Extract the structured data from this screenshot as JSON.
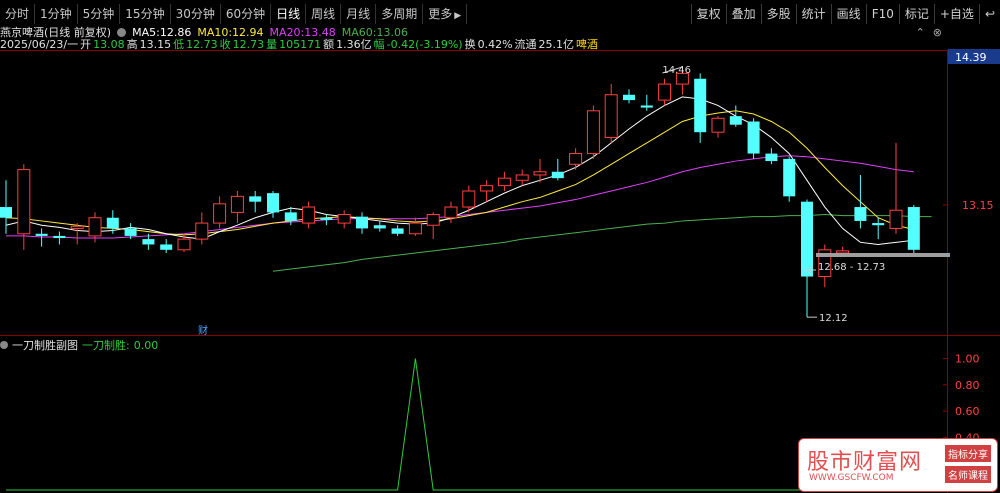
{
  "toolbar": {
    "periods": [
      "分时",
      "1分钟",
      "5分钟",
      "15分钟",
      "30分钟",
      "60分钟",
      "日线",
      "周线",
      "月线",
      "多周期"
    ],
    "more": "更多",
    "right_buttons": [
      "复权",
      "叠加",
      "多股",
      "统计",
      "画线",
      "F10",
      "标记",
      "+自选"
    ],
    "back_icon": "return-arrow-icon"
  },
  "info": {
    "stock_name": "燕京啤酒(日线 前复权)",
    "ma5_label": "MA5:",
    "ma5": "12.86",
    "ma10_label": "MA10:",
    "ma10": "12.94",
    "ma20_label": "MA20:",
    "ma20": "13.48",
    "ma60_label": "MA60:",
    "ma60": "13.06",
    "date": "2025/06/23/一",
    "open_label": "开",
    "open": "13.08",
    "high_label": "高",
    "high": "13.15",
    "low_label": "低",
    "low": "12.73",
    "close_label": "收",
    "close": "12.73",
    "vol_label": "量",
    "vol": "105171",
    "amt_label": "额",
    "amt": "1.36亿",
    "chg_label": "幅",
    "chg": "-0.42(-3.19%)",
    "turnover_label": "换",
    "turnover": "0.42%",
    "float_label": "流通",
    "float": "25.1亿",
    "sector": "啤酒"
  },
  "price_axis": {
    "tag": "14.39",
    "mid": "13.15"
  },
  "annotations": {
    "high": "14.46",
    "low": "12.12",
    "range": "12.68 - 12.73",
    "finance": "财"
  },
  "sub": {
    "title": "一刀制胜副图",
    "value_label": "一刀制胜:",
    "value": "0.00",
    "axis": [
      "1.00",
      "0.80",
      "0.60",
      "0.40"
    ]
  },
  "watermark": {
    "title": "股市财富网",
    "url": "WWW.GSCFW.COM",
    "tag1": "指标分享",
    "tag2": "名师课程"
  },
  "colors": {
    "up": "#ff4040",
    "down": "#54ffff",
    "ma5": "#ffffff",
    "ma10": "#ffeb3b",
    "ma20": "#e040fb",
    "ma60": "#4caf50"
  },
  "chart_data": {
    "type": "candlestick",
    "ylim": [
      12.0,
      14.6
    ],
    "candles": [
      {
        "o": 13.15,
        "h": 13.4,
        "l": 12.9,
        "c": 13.05
      },
      {
        "o": 12.9,
        "h": 13.55,
        "l": 12.75,
        "c": 13.5
      },
      {
        "o": 12.9,
        "h": 12.95,
        "l": 12.78,
        "c": 12.88
      },
      {
        "o": 12.88,
        "h": 12.92,
        "l": 12.8,
        "c": 12.86
      },
      {
        "o": 12.95,
        "h": 13.0,
        "l": 12.8,
        "c": 12.97
      },
      {
        "o": 12.88,
        "h": 13.1,
        "l": 12.82,
        "c": 13.05
      },
      {
        "o": 13.05,
        "h": 13.12,
        "l": 12.9,
        "c": 12.95
      },
      {
        "o": 12.95,
        "h": 13.0,
        "l": 12.85,
        "c": 12.88
      },
      {
        "o": 12.85,
        "h": 12.9,
        "l": 12.75,
        "c": 12.8
      },
      {
        "o": 12.8,
        "h": 12.85,
        "l": 12.72,
        "c": 12.75
      },
      {
        "o": 12.75,
        "h": 12.9,
        "l": 12.73,
        "c": 12.85
      },
      {
        "o": 12.85,
        "h": 13.1,
        "l": 12.8,
        "c": 13.0
      },
      {
        "o": 13.0,
        "h": 13.25,
        "l": 12.95,
        "c": 13.18
      },
      {
        "o": 13.1,
        "h": 13.3,
        "l": 13.0,
        "c": 13.25
      },
      {
        "o": 13.25,
        "h": 13.3,
        "l": 13.1,
        "c": 13.2
      },
      {
        "o": 13.28,
        "h": 13.3,
        "l": 13.05,
        "c": 13.1
      },
      {
        "o": 13.1,
        "h": 13.15,
        "l": 12.98,
        "c": 13.02
      },
      {
        "o": 13.0,
        "h": 13.2,
        "l": 12.95,
        "c": 13.15
      },
      {
        "o": 13.05,
        "h": 13.08,
        "l": 12.98,
        "c": 13.03
      },
      {
        "o": 13.0,
        "h": 13.12,
        "l": 12.95,
        "c": 13.08
      },
      {
        "o": 13.06,
        "h": 13.1,
        "l": 12.9,
        "c": 12.95
      },
      {
        "o": 12.98,
        "h": 13.02,
        "l": 12.92,
        "c": 12.95
      },
      {
        "o": 12.95,
        "h": 12.98,
        "l": 12.88,
        "c": 12.9
      },
      {
        "o": 12.9,
        "h": 13.05,
        "l": 12.88,
        "c": 13.0
      },
      {
        "o": 12.98,
        "h": 13.1,
        "l": 12.85,
        "c": 13.08
      },
      {
        "o": 13.05,
        "h": 13.2,
        "l": 13.0,
        "c": 13.15
      },
      {
        "o": 13.15,
        "h": 13.35,
        "l": 13.1,
        "c": 13.3
      },
      {
        "o": 13.3,
        "h": 13.4,
        "l": 13.2,
        "c": 13.35
      },
      {
        "o": 13.35,
        "h": 13.48,
        "l": 13.3,
        "c": 13.42
      },
      {
        "o": 13.4,
        "h": 13.5,
        "l": 13.35,
        "c": 13.45
      },
      {
        "o": 13.45,
        "h": 13.6,
        "l": 13.38,
        "c": 13.48
      },
      {
        "o": 13.48,
        "h": 13.6,
        "l": 13.4,
        "c": 13.42
      },
      {
        "o": 13.55,
        "h": 13.7,
        "l": 13.5,
        "c": 13.65
      },
      {
        "o": 13.65,
        "h": 14.1,
        "l": 13.6,
        "c": 14.05
      },
      {
        "o": 13.8,
        "h": 14.3,
        "l": 13.75,
        "c": 14.2
      },
      {
        "o": 14.2,
        "h": 14.25,
        "l": 14.12,
        "c": 14.15
      },
      {
        "o": 14.1,
        "h": 14.2,
        "l": 14.05,
        "c": 14.08
      },
      {
        "o": 14.15,
        "h": 14.35,
        "l": 14.1,
        "c": 14.3
      },
      {
        "o": 14.3,
        "h": 14.46,
        "l": 14.2,
        "c": 14.4
      },
      {
        "o": 14.35,
        "h": 14.4,
        "l": 13.75,
        "c": 13.85
      },
      {
        "o": 13.85,
        "h": 14.0,
        "l": 13.8,
        "c": 13.98
      },
      {
        "o": 14.0,
        "h": 14.1,
        "l": 13.9,
        "c": 13.92
      },
      {
        "o": 13.95,
        "h": 13.98,
        "l": 13.6,
        "c": 13.65
      },
      {
        "o": 13.65,
        "h": 13.7,
        "l": 13.55,
        "c": 13.58
      },
      {
        "o": 13.6,
        "h": 13.62,
        "l": 13.2,
        "c": 13.25
      },
      {
        "o": 13.2,
        "h": 13.22,
        "l": 12.12,
        "c": 12.5
      },
      {
        "o": 12.5,
        "h": 12.8,
        "l": 12.4,
        "c": 12.75
      },
      {
        "o": 12.72,
        "h": 12.78,
        "l": 12.7,
        "c": 12.74
      },
      {
        "o": 13.15,
        "h": 13.45,
        "l": 12.95,
        "c": 13.02
      },
      {
        "o": 13.0,
        "h": 13.05,
        "l": 12.85,
        "c": 12.98
      },
      {
        "o": 12.95,
        "h": 13.75,
        "l": 12.9,
        "c": 13.12
      },
      {
        "o": 13.15,
        "h": 13.17,
        "l": 12.72,
        "c": 12.75
      }
    ],
    "ma5": [
      12.98,
      13.02,
      12.98,
      12.96,
      12.93,
      12.92,
      12.93,
      12.96,
      12.94,
      12.9,
      12.87,
      12.85,
      12.92,
      12.98,
      13.05,
      13.1,
      13.14,
      13.12,
      13.08,
      13.06,
      13.04,
      13.02,
      13.0,
      12.99,
      13.0,
      13.05,
      13.12,
      13.2,
      13.28,
      13.35,
      13.4,
      13.45,
      13.52,
      13.62,
      13.75,
      13.88,
      14.0,
      14.1,
      14.18,
      14.16,
      14.1,
      14.0,
      13.92,
      13.8,
      13.65,
      13.4,
      13.15,
      12.95,
      12.82,
      12.8,
      12.82,
      12.84
    ],
    "ma10": [
      13.05,
      13.04,
      13.02,
      13.0,
      12.98,
      12.96,
      12.95,
      12.94,
      12.92,
      12.9,
      12.89,
      12.9,
      12.92,
      12.94,
      12.97,
      13.0,
      13.02,
      13.04,
      13.05,
      13.06,
      13.05,
      13.04,
      13.02,
      13.01,
      13.02,
      13.04,
      13.07,
      13.1,
      13.15,
      13.2,
      13.24,
      13.3,
      13.36,
      13.45,
      13.55,
      13.65,
      13.75,
      13.85,
      13.95,
      14.0,
      14.03,
      14.05,
      14.02,
      13.95,
      13.85,
      13.7,
      13.52,
      13.35,
      13.2,
      13.05,
      12.98,
      12.94
    ],
    "ma20": [
      12.88,
      12.88,
      12.87,
      12.87,
      12.86,
      12.86,
      12.86,
      12.87,
      12.88,
      12.89,
      12.9,
      12.92,
      12.94,
      12.96,
      12.98,
      13.0,
      13.01,
      13.02,
      13.03,
      13.04,
      13.04,
      13.04,
      13.04,
      13.04,
      13.05,
      13.06,
      13.08,
      13.1,
      13.12,
      13.14,
      13.16,
      13.19,
      13.22,
      13.26,
      13.3,
      13.34,
      13.38,
      13.43,
      13.48,
      13.52,
      13.55,
      13.58,
      13.6,
      13.62,
      13.63,
      13.62,
      13.6,
      13.58,
      13.56,
      13.53,
      13.5,
      13.48
    ],
    "ma60_start_index": 15,
    "ma60": [
      12.55,
      12.57,
      12.59,
      12.61,
      12.63,
      12.66,
      12.68,
      12.7,
      12.72,
      12.74,
      12.76,
      12.78,
      12.8,
      12.82,
      12.85,
      12.87,
      12.89,
      12.91,
      12.93,
      12.95,
      12.97,
      12.99,
      13.0,
      13.02,
      13.03,
      13.04,
      13.05,
      13.06,
      13.06,
      13.07,
      13.07,
      13.08,
      13.07,
      13.07,
      13.07,
      13.07,
      13.06,
      13.06
    ],
    "sub": {
      "ylim": [
        0,
        1.05
      ],
      "values": [
        0,
        0,
        0,
        0,
        0,
        0,
        0,
        0,
        0,
        0,
        0,
        0,
        0,
        0,
        0,
        0,
        0,
        0,
        0,
        0,
        0,
        0,
        0,
        1.0,
        0,
        0,
        0,
        0,
        0,
        0,
        0,
        0,
        0,
        0,
        0,
        0,
        0,
        0,
        0,
        0,
        0,
        0,
        0,
        0,
        0,
        0,
        0,
        0,
        0,
        0,
        0,
        0
      ]
    }
  }
}
